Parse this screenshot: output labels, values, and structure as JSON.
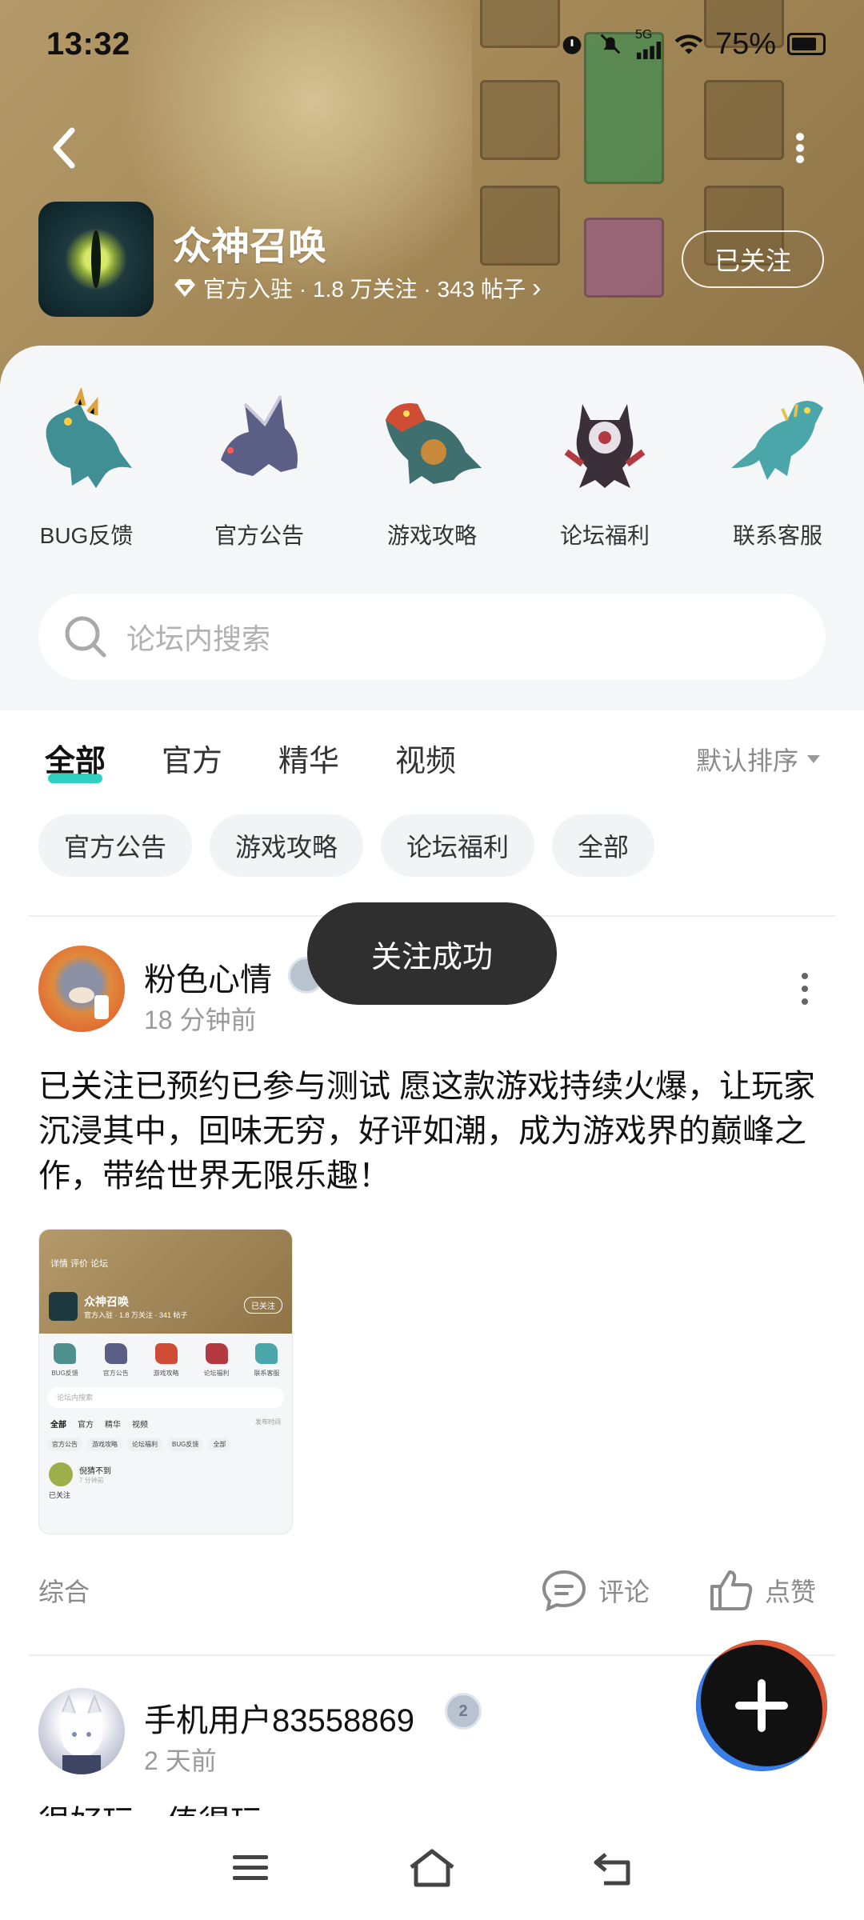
{
  "status_bar": {
    "time": "13:32",
    "network": "5G",
    "battery": "75%",
    "icons": [
      "alarm-icon",
      "mute-icon",
      "signal-icon",
      "wifi-icon",
      "battery-icon"
    ]
  },
  "header": {
    "back_icon": "back-arrow-icon",
    "more_icon": "more-vertical-icon",
    "app_name": "众神召唤",
    "verified_icon": "diamond-verified-icon",
    "meta": "官方入驻 · 1.8 万关注 · 343 帖子",
    "meta_chevron": "›",
    "follow_label": "已关注"
  },
  "categories": [
    {
      "label": "BUG反馈",
      "color": "#3f8f95"
    },
    {
      "label": "官方公告",
      "color": "#5b5f86"
    },
    {
      "label": "游戏攻略",
      "color": "#d04d35"
    },
    {
      "label": "论坛福利",
      "color": "#b43a42"
    },
    {
      "label": "联系客服",
      "color": "#4aa6a8"
    }
  ],
  "search": {
    "placeholder": "论坛内搜索",
    "icon": "search-icon"
  },
  "tabs": [
    {
      "label": "全部",
      "active": true
    },
    {
      "label": "官方",
      "active": false
    },
    {
      "label": "精华",
      "active": false
    },
    {
      "label": "视频",
      "active": false
    }
  ],
  "sort": {
    "label": "默认排序",
    "icon": "caret-down-icon"
  },
  "chips": [
    "官方公告",
    "游戏攻略",
    "论坛福利",
    "全部"
  ],
  "toast": "关注成功",
  "posts": [
    {
      "user": "粉色心情",
      "time": "18 分钟前",
      "text": "已关注已预约已参与测试 愿这款游戏持续火爆，让玩家沉浸其中，回味无穷，好评如潮，成为游戏界的巅峰之作，带给世界无限乐趣！",
      "tag": "综合",
      "comment_label": "评论",
      "like_label": "点赞",
      "thumbnail": {
        "top_nav": "详情  评价  论坛",
        "app_name": "众神召唤",
        "meta": "官方入驻 · 1.8 万关注 · 341 帖子",
        "follow": "已关注",
        "cats": [
          "BUG反馈",
          "官方公告",
          "游戏攻略",
          "论坛福利",
          "联系客服"
        ],
        "search": "论坛内搜索",
        "tabs": [
          "全部",
          "官方",
          "精华",
          "视频"
        ],
        "sort": "发布时间",
        "chips": [
          "官方公告",
          "游戏攻略",
          "论坛福利",
          "BUG反馈",
          "全部"
        ],
        "post_user": "倪猜不到",
        "post_time": "7 分钟前",
        "post_snippet": "已关注"
      }
    },
    {
      "user": "手机用户83558869",
      "time": "2 天前",
      "level": "2",
      "text": "很好玩，值得玩"
    }
  ],
  "fab_icon": "plus-icon",
  "nav": [
    "menu-icon",
    "home-icon",
    "back-icon"
  ],
  "colors": {
    "accent": "#2fd0c0",
    "toast_bg": "#2f2f2f",
    "banner": "#a78b5a"
  }
}
